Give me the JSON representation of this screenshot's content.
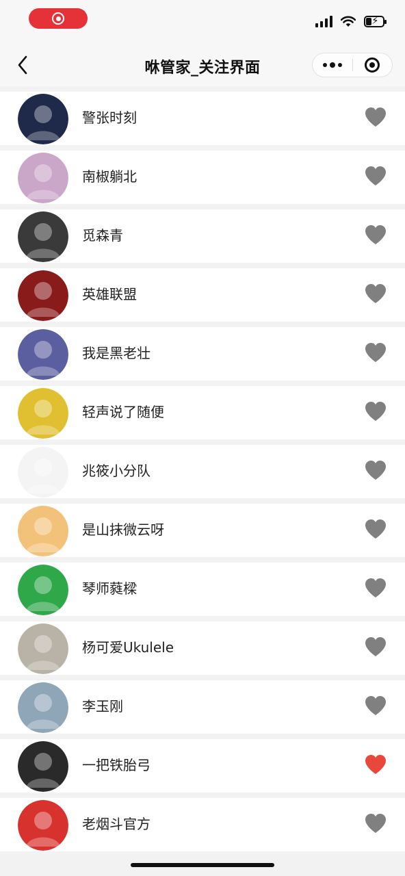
{
  "status_bar": {
    "record_icon": "record-icon",
    "signal_icon": "cellular-signal-icon",
    "wifi_icon": "wifi-icon",
    "battery_icon": "battery-charging-icon"
  },
  "nav": {
    "back_icon": "back-chevron-icon",
    "title": "咻管家_关注界面",
    "more_icon": "more-dots-icon",
    "close_icon": "target-close-icon"
  },
  "colors": {
    "heart_default": "#808080",
    "heart_active": "#e9473c",
    "record_red": "#e53238"
  },
  "follow_list": [
    {
      "name": "警张时刻",
      "liked": false,
      "avatar_color": "#1f2a4a"
    },
    {
      "name": "南椒躺北",
      "liked": false,
      "avatar_color": "#caa6c8"
    },
    {
      "name": "觅森青",
      "liked": false,
      "avatar_color": "#3a3a3a"
    },
    {
      "name": "英雄联盟",
      "liked": false,
      "avatar_color": "#8a1b1b"
    },
    {
      "name": "我是黑老壮",
      "liked": false,
      "avatar_color": "#5b5fa0"
    },
    {
      "name": "轻声说了随便",
      "liked": false,
      "avatar_color": "#e0c030"
    },
    {
      "name": "兆筱小分队",
      "liked": false,
      "avatar_color": "#f4f4f4"
    },
    {
      "name": "是山抹微云呀",
      "liked": false,
      "avatar_color": "#f3c27a"
    },
    {
      "name": "琴师蕤樑",
      "liked": false,
      "avatar_color": "#2fa84a"
    },
    {
      "name": "杨可爱Ukulele",
      "liked": false,
      "avatar_color": "#b9b2a6"
    },
    {
      "name": "李玉刚",
      "liked": false,
      "avatar_color": "#8fa6b8"
    },
    {
      "name": "一把铁胎弓",
      "liked": true,
      "avatar_color": "#2a2a2a"
    },
    {
      "name": "老烟斗官方",
      "liked": false,
      "avatar_color": "#d8322e"
    }
  ]
}
